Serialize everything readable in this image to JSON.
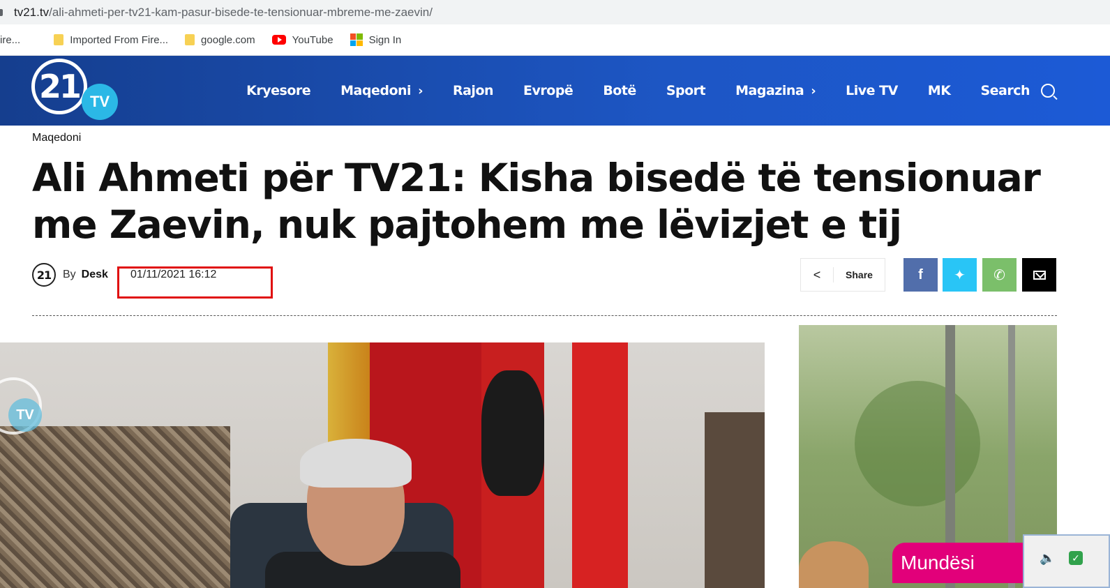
{
  "browser": {
    "url_domain": "tv21.tv",
    "url_path": "/ali-ahmeti-per-tv21-kam-pasur-bisede-te-tensionuar-mbreme-me-zaevin/",
    "bookmarks": [
      {
        "label": "ire...",
        "icon": "none"
      },
      {
        "label": "Imported From Fire...",
        "icon": "folder-icon"
      },
      {
        "label": "google.com",
        "icon": "folder-icon"
      },
      {
        "label": "YouTube",
        "icon": "youtube-icon"
      },
      {
        "label": "Sign In",
        "icon": "microsoft-icon"
      }
    ]
  },
  "site": {
    "logo_number": "21",
    "logo_tv": "TV",
    "nav": {
      "home": "Kryesore",
      "macedonia": "Maqedoni",
      "region": "Rajon",
      "europe": "Evropë",
      "world": "Botë",
      "sport": "Sport",
      "magazine": "Magazina",
      "live": "Live TV",
      "mk": "MK",
      "search": "Search"
    },
    "colors": {
      "header_start": "#153e8e",
      "header_end": "#1c5ad6",
      "highlight": "#e01010"
    }
  },
  "article": {
    "category": "Maqedoni",
    "title": "Ali Ahmeti për TV21: Kisha bisedë të tensionuar me Zaevin, nuk pajtohem me lëvizjet e tij",
    "by_label": "By",
    "author": "Desk",
    "author_avatar_text": "21",
    "date": "01/11/2021 16:12",
    "share_label": "Share",
    "watermark_tv": "TV"
  },
  "ad": {
    "label": "Mundësi"
  }
}
